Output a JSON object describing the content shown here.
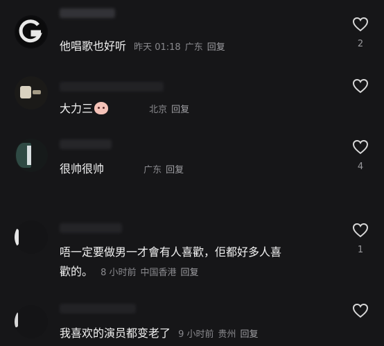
{
  "comments": [
    {
      "text": "他唱歌也好听",
      "time": "昨天 01:18",
      "location": "广东",
      "reply": "回复",
      "likes": "2"
    },
    {
      "text": "大力三",
      "time": "",
      "location": "北京",
      "reply": "回复",
      "likes": ""
    },
    {
      "text": "很帅很帅",
      "time": "",
      "location": "广东",
      "reply": "回复",
      "likes": "4"
    },
    {
      "text_line1": "唔一定要做男一才會有人喜歡，佢都好多人喜",
      "text_line2": "歡的。",
      "time": "8 小时前",
      "location": "中国香港",
      "reply": "回复",
      "likes": "1"
    },
    {
      "text": "我喜欢的演员都变老了",
      "time": "9 小时前",
      "location": "贵州",
      "reply": "回复",
      "likes": ""
    }
  ],
  "icons": {
    "like": "heart-outline-icon",
    "emoji": "pig-face-emoji-icon"
  }
}
